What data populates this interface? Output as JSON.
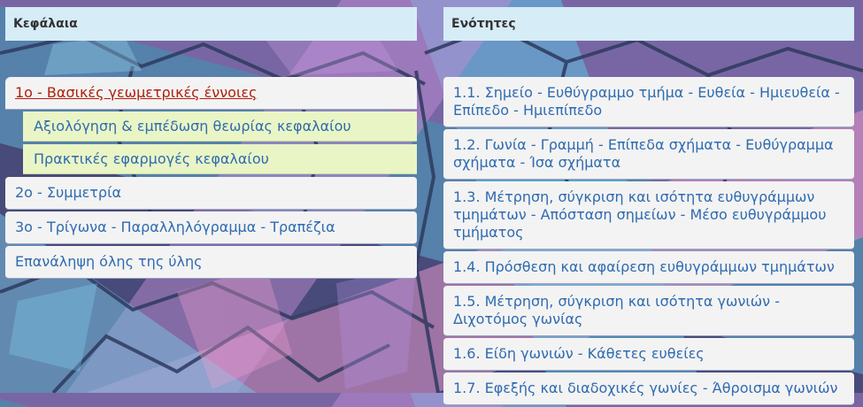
{
  "chapters": {
    "header": "Κεφάλαια",
    "items": [
      {
        "label": "1ο - Βασικές γεωμετρικές έννοιες",
        "active": true
      },
      {
        "label": "2ο - Συμμετρία"
      },
      {
        "label": "3ο - Τρίγωνα - Παραλληλόγραμμα - Τραπέζια"
      },
      {
        "label": "Επανάληψη όλης της ύλης"
      }
    ],
    "subitems": [
      {
        "label": "Αξιολόγηση & εμπέδωση θεωρίας κεφαλαίου"
      },
      {
        "label": "Πρακτικές εφαρμογές κεφαλαίου"
      }
    ]
  },
  "sections": {
    "header": "Ενότητες",
    "items": [
      {
        "label": "1.1. Σημείο - Ευθύγραμμο τμήμα - Ευθεία - Ημιευθεία - Επίπεδο - Ημιεπίπεδο"
      },
      {
        "label": "1.2. Γωνία - Γραμμή - Επίπεδα σχήματα - Ευθύγραμμα σχήματα - Ίσα σχήματα"
      },
      {
        "label": "1.3. Μέτρηση, σύγκριση και ισότητα ευθυγράμμων τμημάτων - Απόσταση σημείων - Μέσο ευθυγράμμου τμήματος"
      },
      {
        "label": "1.4. Πρόσθεση και αφαίρεση ευθυγράμμων τμημάτων"
      },
      {
        "label": "1.5. Μέτρηση, σύγκριση και ισότητα γωνιών - Διχοτόμος γωνίας"
      },
      {
        "label": "1.6. Είδη γωνιών - Κάθετες ευθείες"
      },
      {
        "label": "1.7. Εφεξής και διαδοχικές γωνίες - Άθροισμα γωνιών"
      }
    ]
  },
  "colors": {
    "header_bg": "#d6ecf6",
    "item_bg": "#f3f3f3",
    "subitem_bg": "#eaf5c6",
    "link": "#2f6bb0",
    "active_link": "#b0200c"
  }
}
